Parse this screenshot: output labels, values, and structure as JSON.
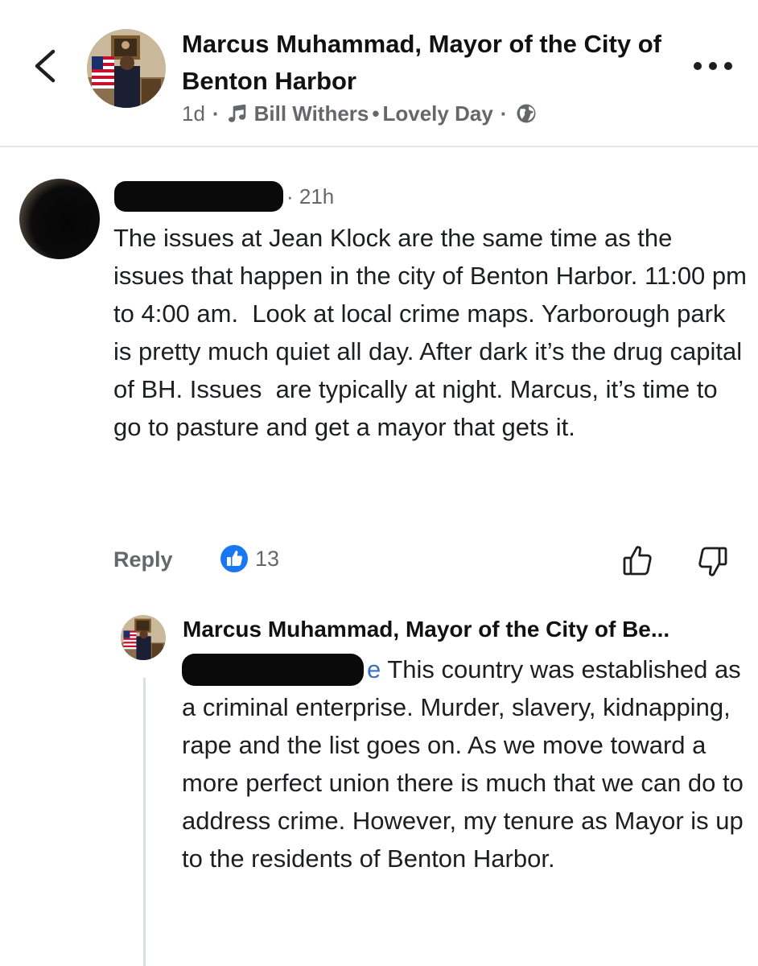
{
  "header": {
    "title": "Marcus Muhammad, Mayor of the City of Benton Harbor",
    "time": "1d",
    "music_artist": "Bill Withers",
    "music_separator": "•",
    "music_title": "Lovely Day",
    "icons": [
      "back-chevron-icon",
      "music-note-icon",
      "globe-icon",
      "more-options-icon"
    ]
  },
  "comment": {
    "author_redacted": true,
    "time": "· 21h",
    "text": "The issues at Jean Klock are the same time as the issues that happen in the city of Benton Harbor. 11:00 pm to 4:00 am.  Look at local crime maps. Yarborough park is pretty much quiet all day. After dark it’s the drug capital of BH. Issues  are typically at night. Marcus, it’s time to go to pasture and get a mayor that gets it.",
    "reply_label": "Reply",
    "like_count": "13",
    "icons": [
      "like-badge-icon",
      "thumbs-up-icon",
      "thumbs-down-icon"
    ]
  },
  "reply": {
    "author": "Marcus Muhammad, Mayor of the City of Be...",
    "mention_visible_tail": "e",
    "text": "This country was established as a criminal enterprise. Murder, slavery, kidnapping, rape and the list goes on. As we move toward a more perfect union there is much that we can do to address crime. However, my tenure as Mayor is up to the residents of Benton Harbor."
  },
  "colors": {
    "like_blue": "#1877f2",
    "secondary_text": "#65676b",
    "mention_blue": "#3a6fc4"
  }
}
